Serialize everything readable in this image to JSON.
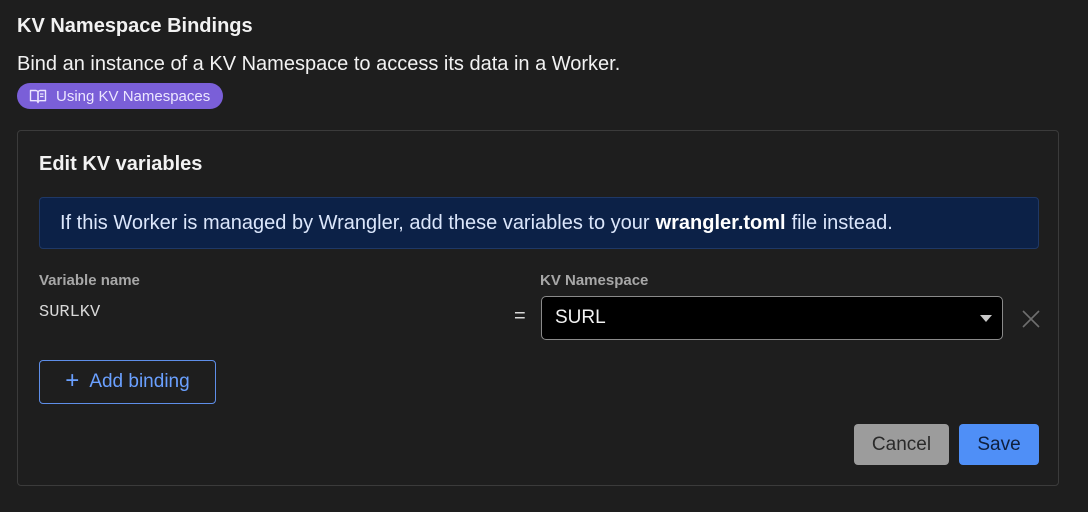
{
  "section": {
    "title": "KV Namespace Bindings",
    "description": "Bind an instance of a KV Namespace to access its data in a Worker.",
    "doc_link_label": "Using KV Namespaces",
    "doc_link_icon": "book-icon"
  },
  "panel": {
    "title": "Edit KV variables",
    "banner": {
      "text_before": "If this Worker is managed by Wrangler, add these variables to your",
      "bold": "wrangler.toml",
      "text_after": "file instead."
    },
    "columns": {
      "variable_name": "Variable name",
      "kv_namespace": "KV Namespace"
    },
    "bindings": [
      {
        "variable_name": "SURLKV",
        "separator": "=",
        "namespace": "SURL"
      }
    ],
    "add_binding_label": "Add binding",
    "cancel_label": "Cancel",
    "save_label": "Save"
  },
  "colors": {
    "background": "#1e1e1e",
    "badge": "#7a5fd8",
    "banner_bg": "#0c2147",
    "accent": "#4f8ff7",
    "cancel_bg": "#9c9c9c"
  }
}
